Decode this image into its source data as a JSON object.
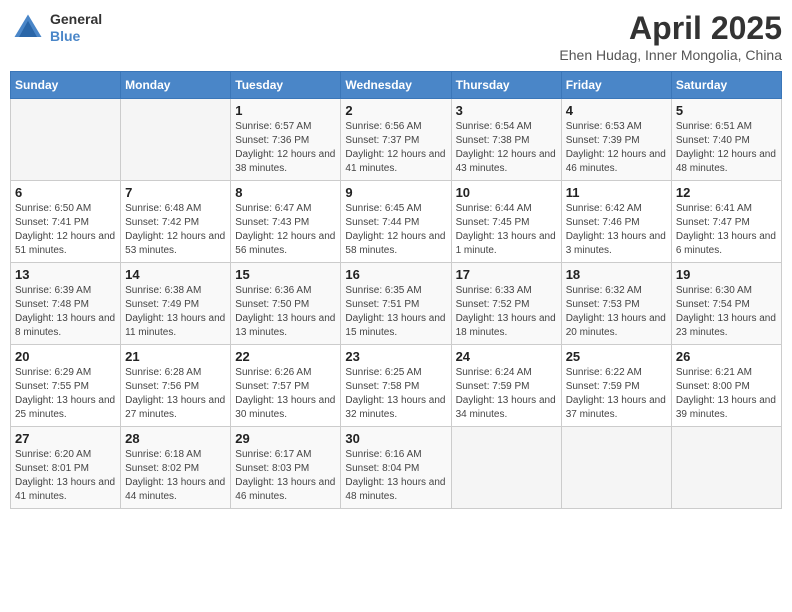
{
  "header": {
    "logo_line1": "General",
    "logo_line2": "Blue",
    "month": "April 2025",
    "location": "Ehen Hudag, Inner Mongolia, China"
  },
  "weekdays": [
    "Sunday",
    "Monday",
    "Tuesday",
    "Wednesday",
    "Thursday",
    "Friday",
    "Saturday"
  ],
  "weeks": [
    [
      {
        "day": "",
        "sunrise": "",
        "sunset": "",
        "daylight": ""
      },
      {
        "day": "",
        "sunrise": "",
        "sunset": "",
        "daylight": ""
      },
      {
        "day": "1",
        "sunrise": "Sunrise: 6:57 AM",
        "sunset": "Sunset: 7:36 PM",
        "daylight": "Daylight: 12 hours and 38 minutes."
      },
      {
        "day": "2",
        "sunrise": "Sunrise: 6:56 AM",
        "sunset": "Sunset: 7:37 PM",
        "daylight": "Daylight: 12 hours and 41 minutes."
      },
      {
        "day": "3",
        "sunrise": "Sunrise: 6:54 AM",
        "sunset": "Sunset: 7:38 PM",
        "daylight": "Daylight: 12 hours and 43 minutes."
      },
      {
        "day": "4",
        "sunrise": "Sunrise: 6:53 AM",
        "sunset": "Sunset: 7:39 PM",
        "daylight": "Daylight: 12 hours and 46 minutes."
      },
      {
        "day": "5",
        "sunrise": "Sunrise: 6:51 AM",
        "sunset": "Sunset: 7:40 PM",
        "daylight": "Daylight: 12 hours and 48 minutes."
      }
    ],
    [
      {
        "day": "6",
        "sunrise": "Sunrise: 6:50 AM",
        "sunset": "Sunset: 7:41 PM",
        "daylight": "Daylight: 12 hours and 51 minutes."
      },
      {
        "day": "7",
        "sunrise": "Sunrise: 6:48 AM",
        "sunset": "Sunset: 7:42 PM",
        "daylight": "Daylight: 12 hours and 53 minutes."
      },
      {
        "day": "8",
        "sunrise": "Sunrise: 6:47 AM",
        "sunset": "Sunset: 7:43 PM",
        "daylight": "Daylight: 12 hours and 56 minutes."
      },
      {
        "day": "9",
        "sunrise": "Sunrise: 6:45 AM",
        "sunset": "Sunset: 7:44 PM",
        "daylight": "Daylight: 12 hours and 58 minutes."
      },
      {
        "day": "10",
        "sunrise": "Sunrise: 6:44 AM",
        "sunset": "Sunset: 7:45 PM",
        "daylight": "Daylight: 13 hours and 1 minute."
      },
      {
        "day": "11",
        "sunrise": "Sunrise: 6:42 AM",
        "sunset": "Sunset: 7:46 PM",
        "daylight": "Daylight: 13 hours and 3 minutes."
      },
      {
        "day": "12",
        "sunrise": "Sunrise: 6:41 AM",
        "sunset": "Sunset: 7:47 PM",
        "daylight": "Daylight: 13 hours and 6 minutes."
      }
    ],
    [
      {
        "day": "13",
        "sunrise": "Sunrise: 6:39 AM",
        "sunset": "Sunset: 7:48 PM",
        "daylight": "Daylight: 13 hours and 8 minutes."
      },
      {
        "day": "14",
        "sunrise": "Sunrise: 6:38 AM",
        "sunset": "Sunset: 7:49 PM",
        "daylight": "Daylight: 13 hours and 11 minutes."
      },
      {
        "day": "15",
        "sunrise": "Sunrise: 6:36 AM",
        "sunset": "Sunset: 7:50 PM",
        "daylight": "Daylight: 13 hours and 13 minutes."
      },
      {
        "day": "16",
        "sunrise": "Sunrise: 6:35 AM",
        "sunset": "Sunset: 7:51 PM",
        "daylight": "Daylight: 13 hours and 15 minutes."
      },
      {
        "day": "17",
        "sunrise": "Sunrise: 6:33 AM",
        "sunset": "Sunset: 7:52 PM",
        "daylight": "Daylight: 13 hours and 18 minutes."
      },
      {
        "day": "18",
        "sunrise": "Sunrise: 6:32 AM",
        "sunset": "Sunset: 7:53 PM",
        "daylight": "Daylight: 13 hours and 20 minutes."
      },
      {
        "day": "19",
        "sunrise": "Sunrise: 6:30 AM",
        "sunset": "Sunset: 7:54 PM",
        "daylight": "Daylight: 13 hours and 23 minutes."
      }
    ],
    [
      {
        "day": "20",
        "sunrise": "Sunrise: 6:29 AM",
        "sunset": "Sunset: 7:55 PM",
        "daylight": "Daylight: 13 hours and 25 minutes."
      },
      {
        "day": "21",
        "sunrise": "Sunrise: 6:28 AM",
        "sunset": "Sunset: 7:56 PM",
        "daylight": "Daylight: 13 hours and 27 minutes."
      },
      {
        "day": "22",
        "sunrise": "Sunrise: 6:26 AM",
        "sunset": "Sunset: 7:57 PM",
        "daylight": "Daylight: 13 hours and 30 minutes."
      },
      {
        "day": "23",
        "sunrise": "Sunrise: 6:25 AM",
        "sunset": "Sunset: 7:58 PM",
        "daylight": "Daylight: 13 hours and 32 minutes."
      },
      {
        "day": "24",
        "sunrise": "Sunrise: 6:24 AM",
        "sunset": "Sunset: 7:59 PM",
        "daylight": "Daylight: 13 hours and 34 minutes."
      },
      {
        "day": "25",
        "sunrise": "Sunrise: 6:22 AM",
        "sunset": "Sunset: 7:59 PM",
        "daylight": "Daylight: 13 hours and 37 minutes."
      },
      {
        "day": "26",
        "sunrise": "Sunrise: 6:21 AM",
        "sunset": "Sunset: 8:00 PM",
        "daylight": "Daylight: 13 hours and 39 minutes."
      }
    ],
    [
      {
        "day": "27",
        "sunrise": "Sunrise: 6:20 AM",
        "sunset": "Sunset: 8:01 PM",
        "daylight": "Daylight: 13 hours and 41 minutes."
      },
      {
        "day": "28",
        "sunrise": "Sunrise: 6:18 AM",
        "sunset": "Sunset: 8:02 PM",
        "daylight": "Daylight: 13 hours and 44 minutes."
      },
      {
        "day": "29",
        "sunrise": "Sunrise: 6:17 AM",
        "sunset": "Sunset: 8:03 PM",
        "daylight": "Daylight: 13 hours and 46 minutes."
      },
      {
        "day": "30",
        "sunrise": "Sunrise: 6:16 AM",
        "sunset": "Sunset: 8:04 PM",
        "daylight": "Daylight: 13 hours and 48 minutes."
      },
      {
        "day": "",
        "sunrise": "",
        "sunset": "",
        "daylight": ""
      },
      {
        "day": "",
        "sunrise": "",
        "sunset": "",
        "daylight": ""
      },
      {
        "day": "",
        "sunrise": "",
        "sunset": "",
        "daylight": ""
      }
    ]
  ]
}
